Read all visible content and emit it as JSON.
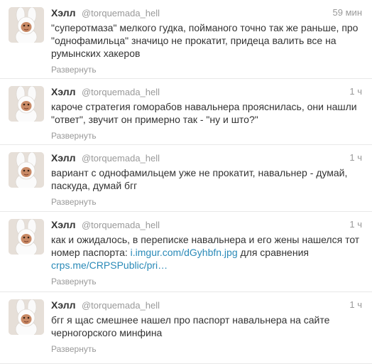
{
  "tweets": [
    {
      "name": "Хэлл",
      "handle": "@torquemada_hell",
      "time": "59 мин",
      "text": "\"суперотмаза\" мелкого гудка, пойманого точно так же раньше, про \"однофамильца\" значицо не прокатит, придеца валить все на румынских хакеров",
      "expand": "Развернуть"
    },
    {
      "name": "Хэлл",
      "handle": "@torquemada_hell",
      "time": "1 ч",
      "text": "кароче стратегия гоморабов навальнера прояснилась, они нашли \"ответ\", звучит он примерно так - \"ну и што?\"",
      "expand": "Развернуть"
    },
    {
      "name": "Хэлл",
      "handle": "@torquemada_hell",
      "time": "1 ч",
      "text": "вариант с однофамильцем уже не прокатит, навальнер - думай, паскуда, думай бгг",
      "expand": "Развернуть"
    },
    {
      "name": "Хэлл",
      "handle": "@torquemada_hell",
      "time": "1 ч",
      "text": "как и ожидалось, в переписке навальнера и его жены нашелся тот номер паспорта:",
      "link1": "i.imgur.com/dGyhbfn.jpg",
      "text_mid": "для сравнения",
      "link2": "crps.me/CRPSPublic/pri…",
      "expand": "Развернуть"
    },
    {
      "name": "Хэлл",
      "handle": "@torquemada_hell",
      "time": "1 ч",
      "text": "бгг я щас смешнее нашел про паспорт навальнера на сайте черногорского минфина",
      "expand": "Развернуть"
    }
  ]
}
